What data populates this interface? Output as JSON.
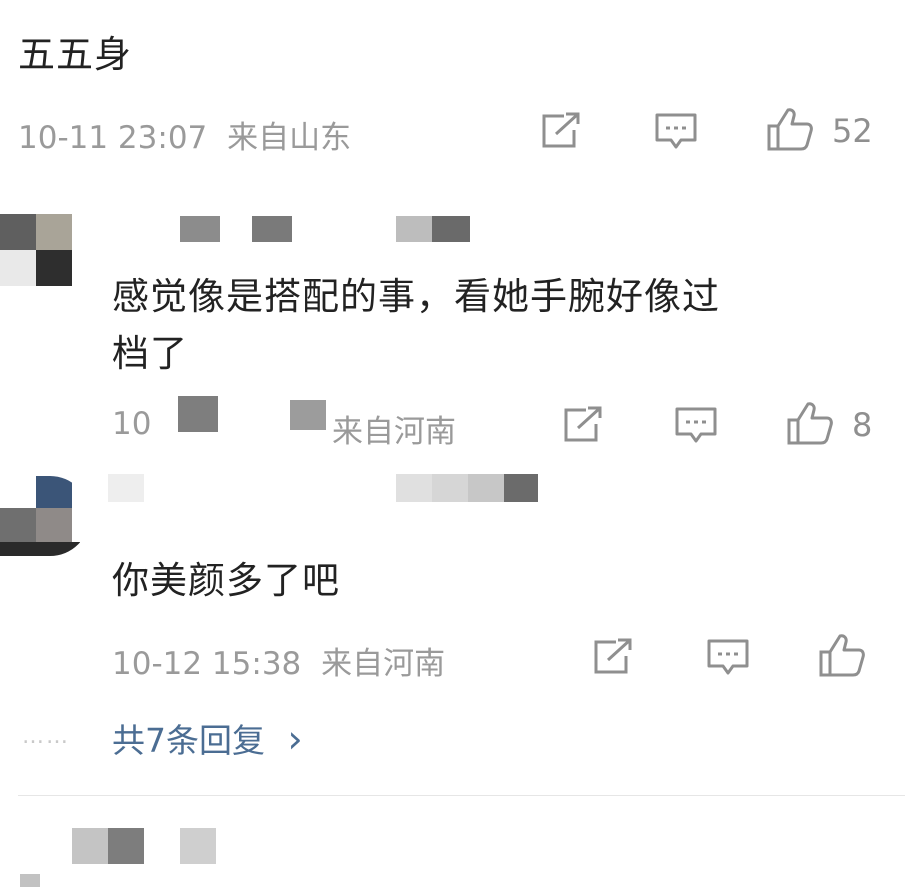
{
  "comment_top": {
    "text": "五五身",
    "time": "10-11 23:07",
    "location": "来自山东",
    "likes": "52"
  },
  "reply_1": {
    "text_line1": "感觉像是搭配的事，看她手腕好像过",
    "text_line2": "档了",
    "meta_partial": "10",
    "location": "来自河南",
    "likes": "8"
  },
  "reply_2": {
    "text": "你美颜多了吧",
    "time": "10-12 15:38",
    "location": "来自河南"
  },
  "more_replies": {
    "dots": "……",
    "label": "共7条回复",
    "chevron": "›"
  },
  "icons": {
    "share": "share-icon",
    "comment": "comment-icon",
    "like": "thumbs-up-icon"
  },
  "colors": {
    "text": "#222222",
    "meta": "#9a9a9a",
    "link": "#4b6d93",
    "icon": "#8f8f8f"
  }
}
